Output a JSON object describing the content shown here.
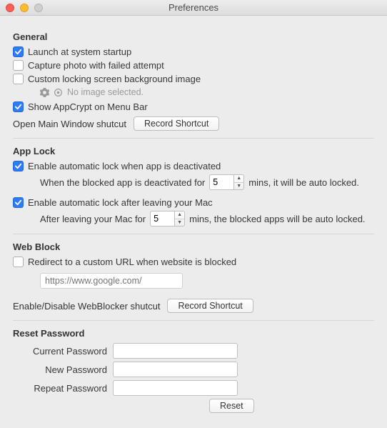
{
  "window": {
    "title": "Preferences"
  },
  "sections": {
    "general": {
      "heading": "General",
      "launch_label": "Launch at system startup",
      "capture_label": "Capture photo with failed attempt",
      "custom_bg_label": "Custom locking screen background image",
      "no_image_text": "No image selected.",
      "menubar_label": "Show AppCrypt on Menu Bar",
      "open_main_label": "Open Main Window shutcut",
      "record_shortcut_btn": "Record Shortcut"
    },
    "applock": {
      "heading": "App Lock",
      "auto_deact_label": "Enable automatic lock when app is deactivated",
      "auto_deact_sentence_pre": "When the blocked app is deactivated for",
      "auto_deact_value": "5",
      "auto_deact_sentence_post": "mins, it will be auto locked.",
      "auto_leave_label": "Enable automatic lock after leaving your Mac",
      "auto_leave_sentence_pre": "After leaving your Mac for",
      "auto_leave_value": "5",
      "auto_leave_sentence_post": "mins, the blocked apps will be auto locked."
    },
    "webblock": {
      "heading": "Web Block",
      "redirect_label": "Redirect to a custom URL when website is blocked",
      "url_placeholder": "https://www.google.com/",
      "webblocker_shortcut_label": "Enable/Disable WebBlocker shutcut",
      "record_shortcut_btn": "Record Shortcut"
    },
    "reset": {
      "heading": "Reset Password",
      "current_label": "Current Password",
      "new_label": "New Password",
      "repeat_label": "Repeat Password",
      "reset_btn": "Reset"
    }
  },
  "checkbox_state": {
    "launch": true,
    "capture": false,
    "custom_bg": false,
    "menubar": true,
    "auto_deact": true,
    "auto_leave": true,
    "redirect": false
  }
}
